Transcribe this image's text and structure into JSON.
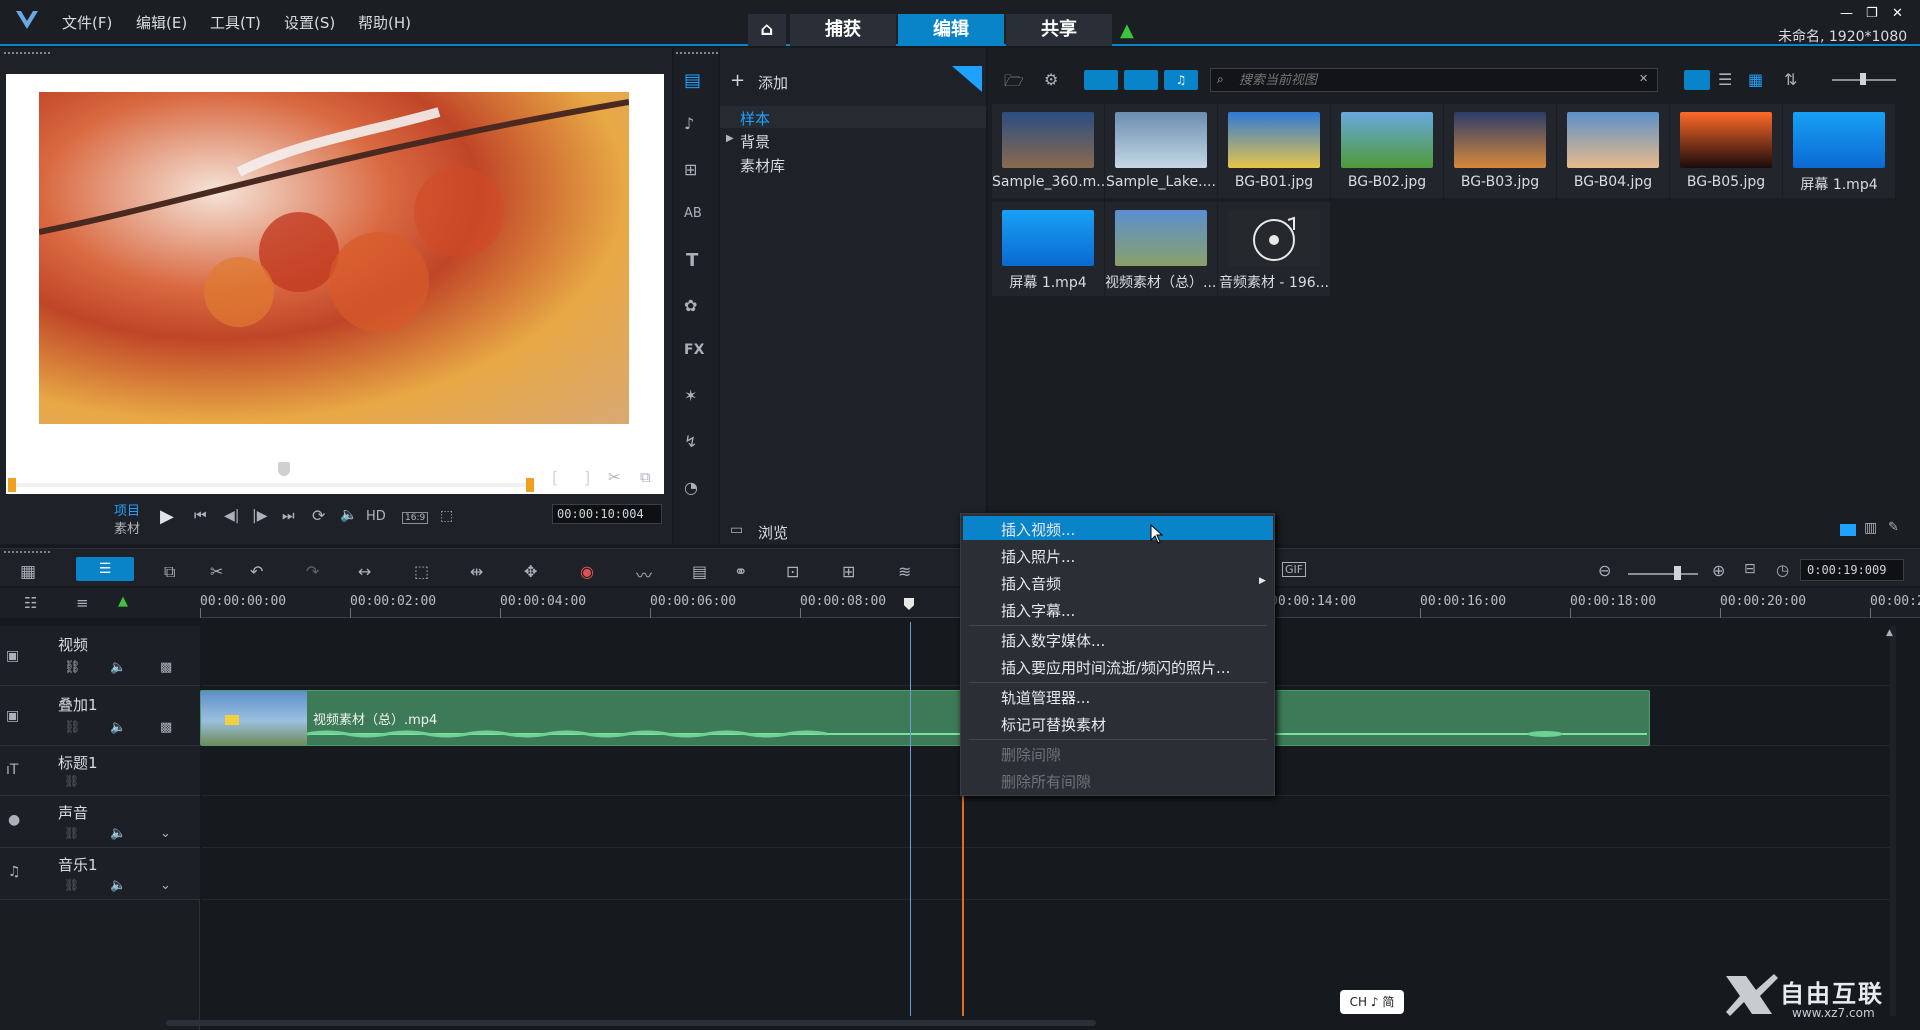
{
  "menu": {
    "file": "文件(F)",
    "edit": "编辑(E)",
    "tools": "工具(T)",
    "settings": "设置(S)",
    "help": "帮助(H)"
  },
  "nav": {
    "capture": "捕获",
    "edit": "编辑",
    "share": "共享"
  },
  "title_info": "未命名, 1920*1080",
  "player": {
    "project_label": "项目",
    "clip_label": "素材",
    "hd": "HD",
    "ratio": "16:9",
    "timecode": "00:00:10:004",
    "mark_in": "[",
    "mark_out": "]"
  },
  "library": {
    "add_label": "添加",
    "tree": [
      {
        "label": "样本",
        "selected": true
      },
      {
        "label": "背景",
        "selected": false
      },
      {
        "label": "素材库",
        "selected": false
      }
    ],
    "browse_label": "浏览",
    "search_placeholder": "搜索当前视图",
    "thumbs": [
      {
        "label": "Sample_360.m...",
        "colors": [
          "#2b4d82",
          "#8a6a4f"
        ]
      },
      {
        "label": "Sample_Lake....",
        "colors": [
          "#6a8eb0",
          "#c5d7e6"
        ]
      },
      {
        "label": "BG-B01.jpg",
        "colors": [
          "#2f79d6",
          "#e6c54a"
        ]
      },
      {
        "label": "BG-B02.jpg",
        "colors": [
          "#68a8df",
          "#4f9a38"
        ]
      },
      {
        "label": "BG-B03.jpg",
        "colors": [
          "#2c3d6b",
          "#d7883a"
        ]
      },
      {
        "label": "BG-B04.jpg",
        "colors": [
          "#5b90c9",
          "#e9ba8a"
        ]
      },
      {
        "label": "BG-B05.jpg",
        "colors": [
          "#ff6a2a",
          "#1a0b0b"
        ]
      },
      {
        "label": "屏幕 1.mp4",
        "colors": [
          "#18a0f5",
          "#0b6ad2"
        ]
      },
      {
        "label": "屏幕 1.mp4",
        "colors": [
          "#18a0f5",
          "#0b6ad2"
        ]
      },
      {
        "label": "视频素材（总）....",
        "colors": [
          "#5b8fd0",
          "#8aa06a"
        ]
      },
      {
        "label": "音频素材 - 196...",
        "colors": [
          "#2a2d33",
          "#2a2d33"
        ]
      }
    ]
  },
  "timeline": {
    "timecode": "0:00:19:009",
    "ruler": [
      "00:00:00:00",
      "00:00:02:00",
      "00:00:04:00",
      "00:00:06:00",
      "00:00:08:00",
      "00:00:14:00",
      "00:00:16:00",
      "00:00:18:00",
      "00:00:20:00",
      "00:00:2"
    ],
    "tracks": [
      {
        "name": "视频",
        "icon": "video-camera-icon"
      },
      {
        "name": "叠加1",
        "icon": "overlay-icon"
      },
      {
        "name": "标题1",
        "icon": "title-icon"
      },
      {
        "name": "声音",
        "icon": "voice-icon"
      },
      {
        "name": "音乐1",
        "icon": "music-icon"
      }
    ],
    "clip_label": "视频素材（总）.mp4"
  },
  "context_menu": [
    {
      "label": "插入视频...",
      "state": "highlighted"
    },
    {
      "label": "插入照片...",
      "state": "normal"
    },
    {
      "label": "插入音频",
      "state": "submenu"
    },
    {
      "label": "插入字幕...",
      "state": "normal"
    },
    {
      "label": "插入数字媒体...",
      "state": "normal"
    },
    {
      "label": "插入要应用时间流逝/频闪的照片...",
      "state": "normal"
    },
    {
      "label": "轨道管理器...",
      "state": "normal"
    },
    {
      "label": "标记可替换素材",
      "state": "normal"
    },
    {
      "label": "删除间隙",
      "state": "disabled"
    },
    {
      "label": "删除所有间隙",
      "state": "disabled"
    }
  ],
  "ime": "CH ♪ 简",
  "watermark": {
    "brand": "自由互联",
    "url": "www.xz7.com"
  }
}
